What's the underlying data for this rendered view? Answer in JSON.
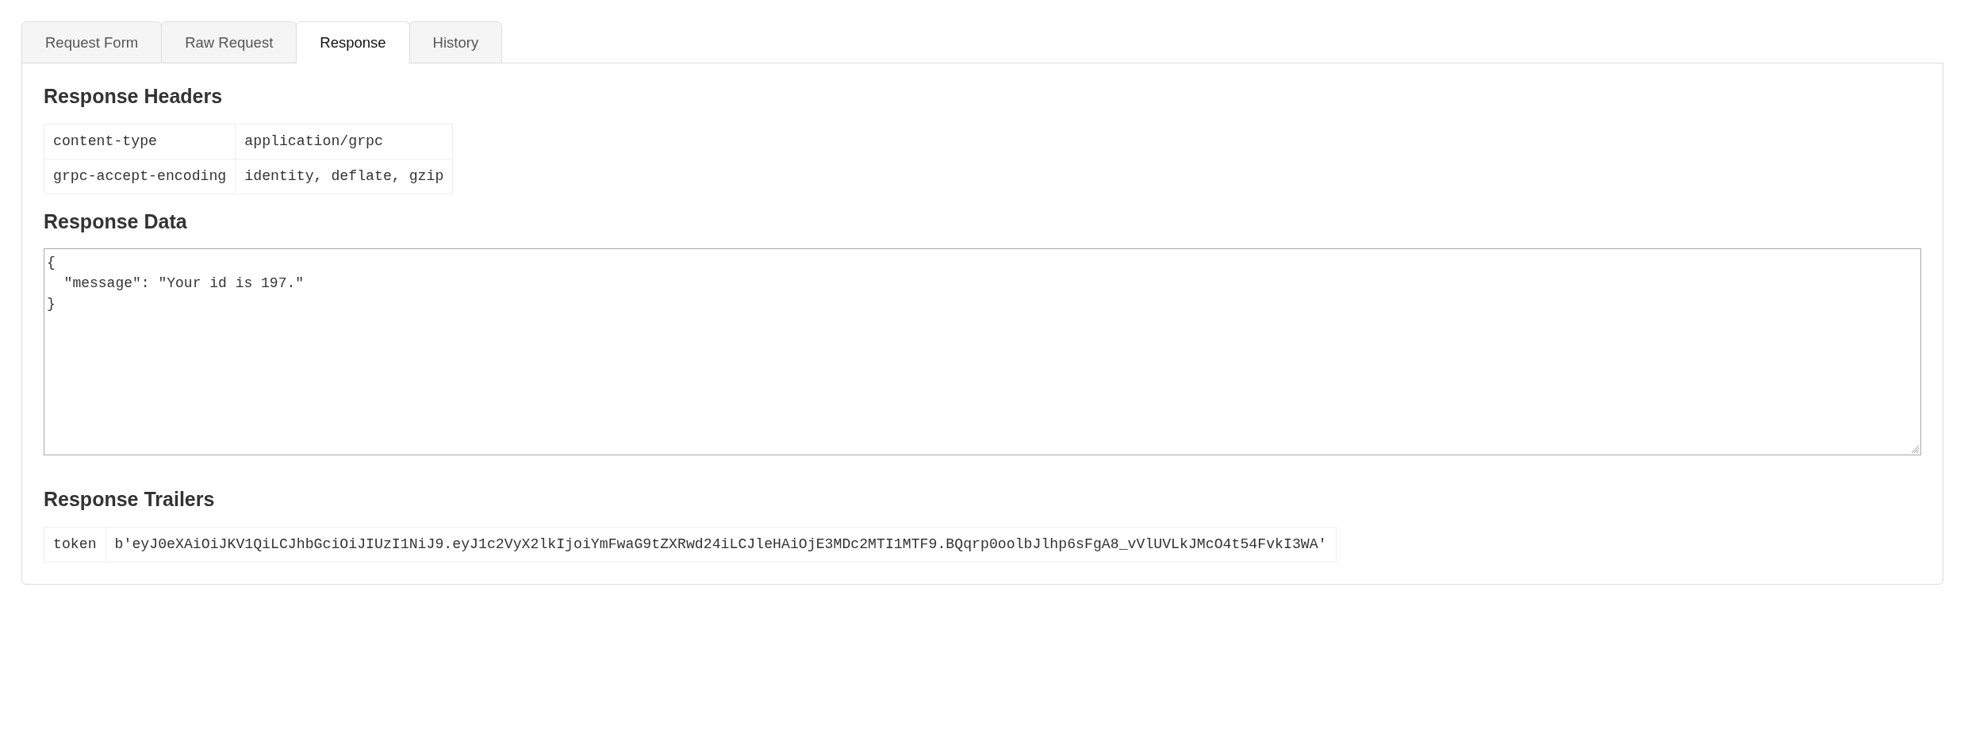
{
  "tabs": [
    {
      "label": "Request Form",
      "selected": false
    },
    {
      "label": "Raw Request",
      "selected": false
    },
    {
      "label": "Response",
      "selected": true
    },
    {
      "label": "History",
      "selected": false
    }
  ],
  "response_headers": {
    "title": "Response Headers",
    "rows": [
      {
        "name": "content-type",
        "value": "application/grpc"
      },
      {
        "name": "grpc-accept-encoding",
        "value": "identity, deflate, gzip"
      }
    ]
  },
  "response_data": {
    "title": "Response Data",
    "value": "{\n  \"message\": \"Your id is 197.\"\n}"
  },
  "response_trailers": {
    "title": "Response Trailers",
    "rows": [
      {
        "name": "token",
        "value": "b'eyJ0eXAiOiJKV1QiLCJhbGciOiJIUzI1NiJ9.eyJ1c2VyX2lkIjoiYmFwaG9tZXRwd24iLCJleHAiOjE3MDc2MTI1MTF9.BQqrp0oolbJlhp6sFgA8_vVlUVLkJMcO4t54FvkI3WA'"
      }
    ]
  }
}
